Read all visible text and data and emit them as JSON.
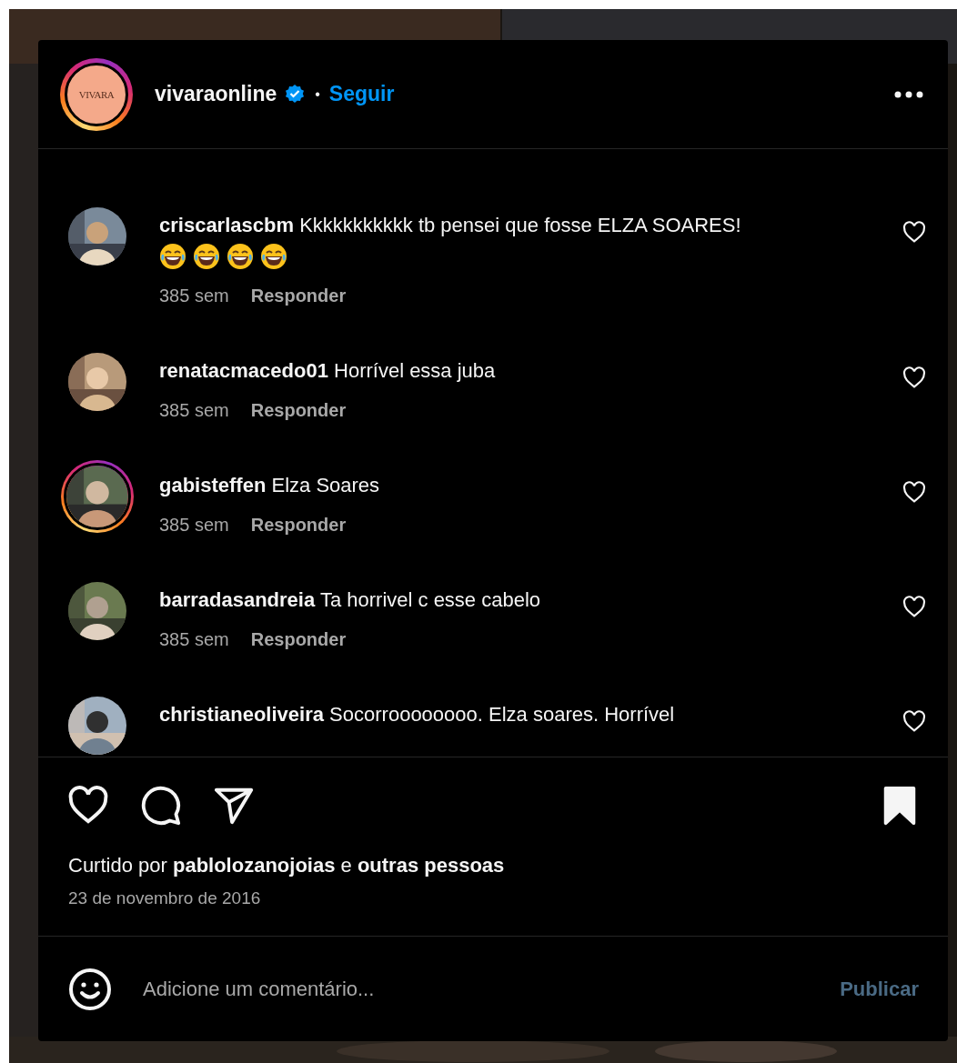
{
  "post_header": {
    "logo_text": "VIVARA",
    "username": "vivaraonline",
    "verified": true,
    "separator": "•",
    "follow_label": "Seguir"
  },
  "comments": [
    {
      "kind": "full",
      "username": "criscarlascbm",
      "text": "Kkkkkkkkkkk tb pensei que fosse ELZA SOARES!",
      "reactions": [
        {
          "kind": "laughing"
        },
        {
          "kind": "laughing"
        },
        {
          "kind": "laughing"
        },
        {
          "kind": "laughing"
        }
      ],
      "story_ring": false,
      "time": "385 sem",
      "reply_label": "Responder"
    },
    {
      "kind": "full",
      "username": "renatacmacedo01",
      "text": "Horrível essa juba",
      "story_ring": false,
      "time": "385 sem",
      "reply_label": "Responder"
    },
    {
      "kind": "full",
      "username": "gabisteffen",
      "text": "Elza Soares",
      "story_ring": true,
      "time": "385 sem",
      "reply_label": "Responder"
    },
    {
      "kind": "full",
      "username": "barradasandreia",
      "text": "Ta horrivel c esse cabelo",
      "story_ring": false,
      "time": "385 sem",
      "reply_label": "Responder"
    },
    {
      "kind": "full",
      "username": "christianeoliveira",
      "text": "Socorroooooooo. Elza soares. Horrível",
      "story_ring": false
    }
  ],
  "actions": {
    "saved": true
  },
  "likes": "Curtido por **pablolozanojoias** e **outras pessoas**",
  "date": "23 de novembro de 2016",
  "comment_box": {
    "placeholder": "Adicione um comentário...",
    "submit_label": "Publicar",
    "disabled": true
  }
}
